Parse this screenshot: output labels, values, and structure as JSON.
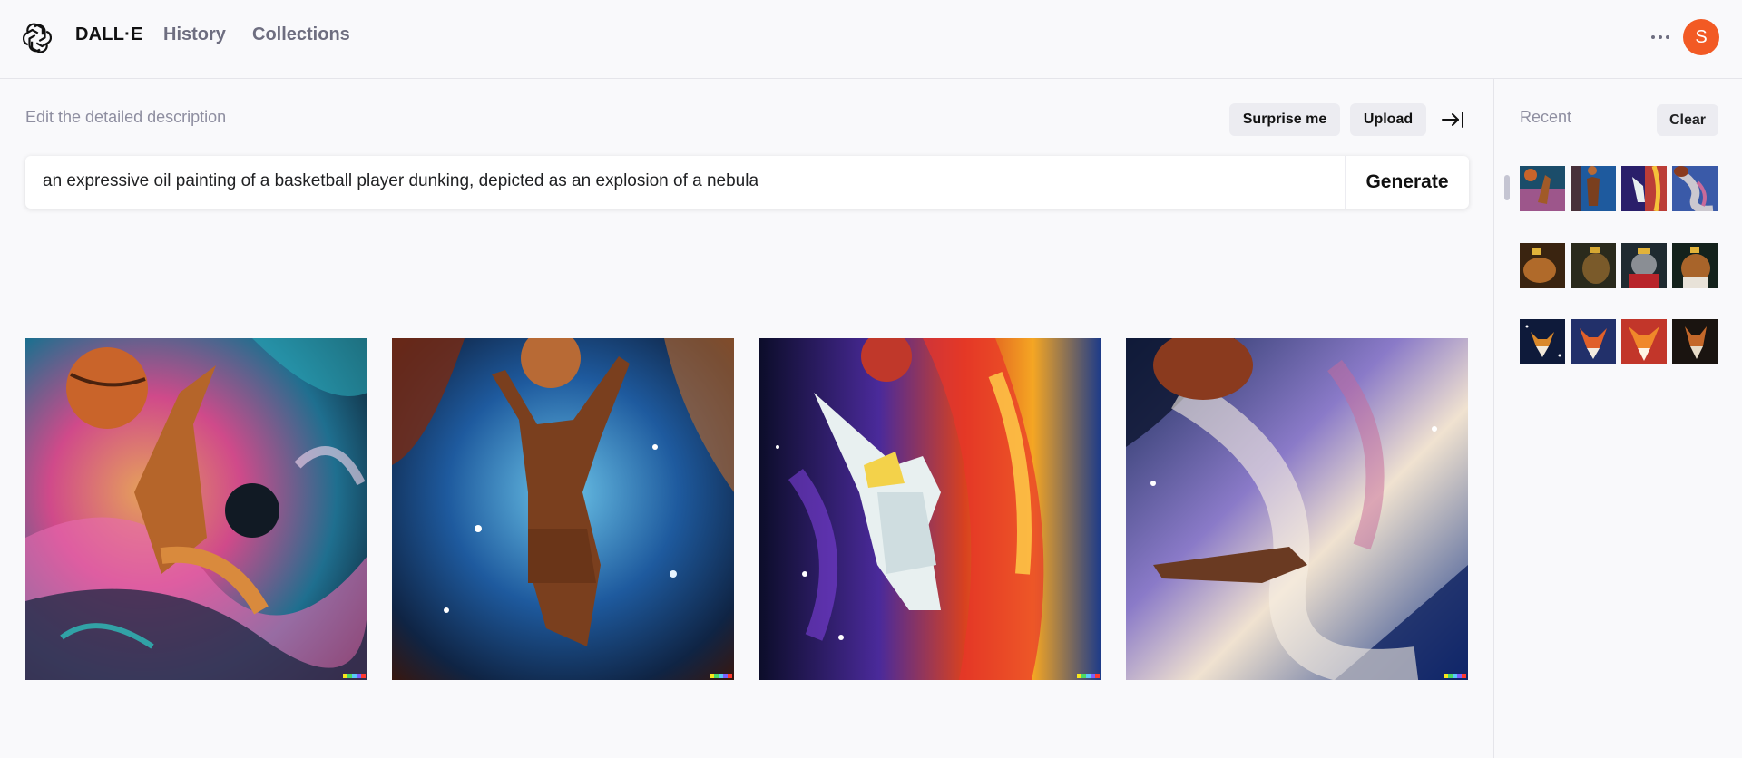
{
  "header": {
    "brand": "DALL·E",
    "nav": [
      "History",
      "Collections"
    ],
    "avatar_initial": "S",
    "avatar_color": "#f25a24"
  },
  "editor": {
    "label": "Edit the detailed description",
    "surprise_label": "Surprise me",
    "upload_label": "Upload",
    "prompt": "an expressive oil painting of a basketball player dunking, depicted as an explosion of a nebula",
    "generate_label": "Generate"
  },
  "results": [
    {
      "icon": "basketball-painting-1"
    },
    {
      "icon": "basketball-painting-2"
    },
    {
      "icon": "basketball-painting-3"
    },
    {
      "icon": "basketball-painting-4"
    }
  ],
  "sidebar": {
    "title": "Recent",
    "clear_label": "Clear",
    "groups": [
      {
        "subject": "basketball-nebula"
      },
      {
        "subject": "capybara-royal"
      },
      {
        "subject": "fox-portrait"
      }
    ]
  },
  "colors": {
    "watermark": [
      "#f8e71c",
      "#4cd964",
      "#5ac8fa",
      "#7b61ff",
      "#ff3b30"
    ]
  }
}
